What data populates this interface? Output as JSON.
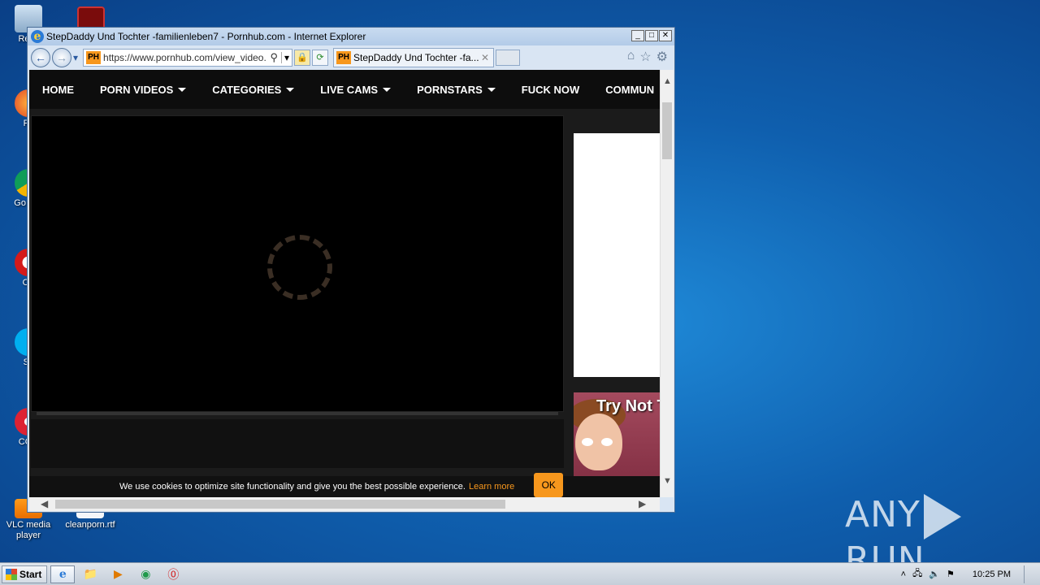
{
  "desktop": {
    "icons": [
      {
        "label": "Recy"
      },
      {
        "label": "Fir"
      },
      {
        "label": "Go Chr"
      },
      {
        "label": "Op"
      },
      {
        "label": "Sk"
      },
      {
        "label": "CCle"
      },
      {
        "label": "VLC media player"
      },
      {
        "label": "cleanporn.rtf"
      }
    ],
    "watermark": {
      "left": "ANY",
      "right": "RUN"
    }
  },
  "window": {
    "title": "StepDaddy Und Tochter -familienleben7 - Pornhub.com - Internet Explorer",
    "controls": {
      "minimize": "_",
      "maximize": "□",
      "close": "✕"
    }
  },
  "toolbar": {
    "back": "←",
    "forward": "→",
    "site_badge": "PH",
    "address": "https://www.pornhub.com/view_video.ph",
    "search_glyph": "⚲",
    "dropdown_glyph": "▾",
    "lock_glyph": "🔒",
    "refresh_glyph": "⟳",
    "tab_badge": "PH",
    "tab_label": "StepDaddy Und Tochter -fa...",
    "tab_close": "✕",
    "home_glyph": "⌂",
    "fav_glyph": "☆",
    "tools_glyph": "⚙"
  },
  "site": {
    "menu": [
      {
        "label": "HOME",
        "caret": false
      },
      {
        "label": "PORN VIDEOS",
        "caret": true
      },
      {
        "label": "CATEGORIES",
        "caret": true
      },
      {
        "label": "LIVE CAMS",
        "caret": true
      },
      {
        "label": "PORNSTARS",
        "caret": true
      },
      {
        "label": "FUCK NOW",
        "caret": false
      },
      {
        "label": "COMMUN",
        "caret": false
      }
    ],
    "ad_text": "Try Not T",
    "cookie": {
      "text": "We use cookies to optimize site functionality and give you the best possible experience.",
      "link": "Learn more",
      "ok": "OK"
    }
  },
  "scroll": {
    "up": "▲",
    "down": "▼",
    "left": "◀",
    "right": "▶"
  },
  "taskbar": {
    "start_label": "Start",
    "items": [
      "e",
      "📁",
      "▶",
      "◉",
      "⓪"
    ],
    "tray": {
      "arrow": "˄",
      "net": "🖧",
      "vol": "🔈",
      "flag": "⚑"
    },
    "clock": "10:25 PM"
  }
}
